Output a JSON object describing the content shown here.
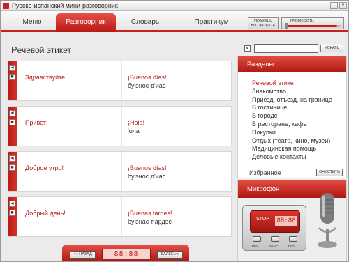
{
  "window": {
    "title": "Русско-испанский мини-разговорник",
    "minimize": "_",
    "close": "×"
  },
  "tabs": [
    {
      "label": "Меню",
      "active": false
    },
    {
      "label": "Разговорник",
      "active": true
    },
    {
      "label": "Словарь",
      "active": false
    },
    {
      "label": "Практикум",
      "active": false
    }
  ],
  "toolbar": {
    "help_line1": "ПОМОЩЬ",
    "help_line2": "ВО ПРОЕКТЕ",
    "volume_label": "ГРОМКОСТЬ",
    "volume_level": 0.92
  },
  "section": {
    "title_cap": "Р",
    "title_rest": "ечевой этикет",
    "search_value": "",
    "search_clear": "×",
    "search_button": "ИСКАТЬ"
  },
  "cards": [
    {
      "ru": "Здравствуйте!",
      "es": "¡Buenos días!",
      "tr": "бу'энос д'иас"
    },
    {
      "ru": "Привет!",
      "es": "¡Hola!",
      "tr": "'ола"
    },
    {
      "ru": "Доброе утро!",
      "es": "¡Buenos días!",
      "tr": "бу'энос д'иас"
    },
    {
      "ru": "Добрый день!",
      "es": "¡Buenas tardes!",
      "tr": "бу'энас т'ардэс"
    }
  ],
  "card_buttons": {
    "play": "◄",
    "add": "■"
  },
  "footer": {
    "back": "<< НАЗАД",
    "forward": "ДАЛЕЕ >>",
    "counter": "88:88"
  },
  "sidebar": {
    "header": "Разделы",
    "items": [
      "Речевой этикет",
      "Знакомство",
      "Приезд, отъезд, на границе",
      "В гостинице",
      "В городе",
      "В ресторане, кафе",
      "Покупки",
      "Отдых (театр, кино, музеи)",
      "Медицинская помощь",
      "Деловые контакты"
    ],
    "active_index": 0,
    "favorites": "Избранное",
    "clear_button": "ОЧИСТИТЬ"
  },
  "microphone": {
    "header": "Микрофон",
    "stop_label": "STOP",
    "time": "88:88",
    "btn_rec": "REC",
    "btn_stop": "STOP",
    "btn_play": "PLAY"
  },
  "colors": {
    "accent": "#c8201c",
    "accent_dark": "#b01813"
  }
}
